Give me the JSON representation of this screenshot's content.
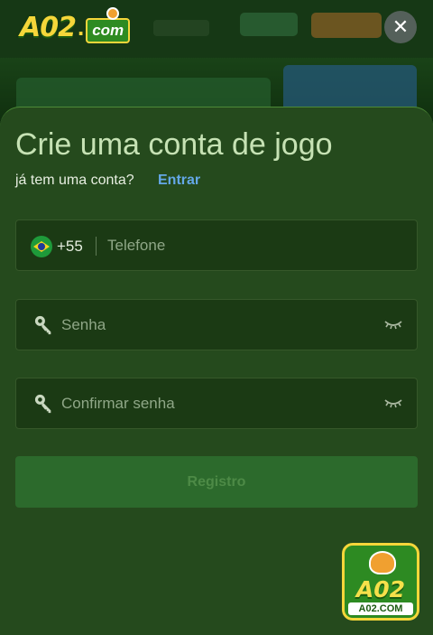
{
  "brand": {
    "logo_main": "A02",
    "logo_dot": ".",
    "logo_suffix": "com",
    "badge_main": "A02",
    "badge_domain": "A02.COM"
  },
  "modal": {
    "title": "Crie uma conta de jogo",
    "subtitle": "já tem uma conta?",
    "login_link": "Entrar",
    "close_label": "✕"
  },
  "form": {
    "phone": {
      "country_code": "+55",
      "country_flag": "brazil-flag-icon",
      "placeholder": "Telefone",
      "value": ""
    },
    "password": {
      "placeholder": "Senha",
      "value": "",
      "leading_icon": "key-icon",
      "trailing_icon": "eye-closed-icon"
    },
    "confirm_password": {
      "placeholder": "Confirmar senha",
      "value": "",
      "leading_icon": "key-icon",
      "trailing_icon": "eye-closed-icon"
    },
    "submit_label": "Registro"
  },
  "colors": {
    "sheet_bg": "#254a1d",
    "field_bg": "#1b3a14",
    "title": "#c6e2b4",
    "link": "#64a8e8",
    "button_bg": "#2c6a2c",
    "brand_yellow": "#f5d63a"
  }
}
